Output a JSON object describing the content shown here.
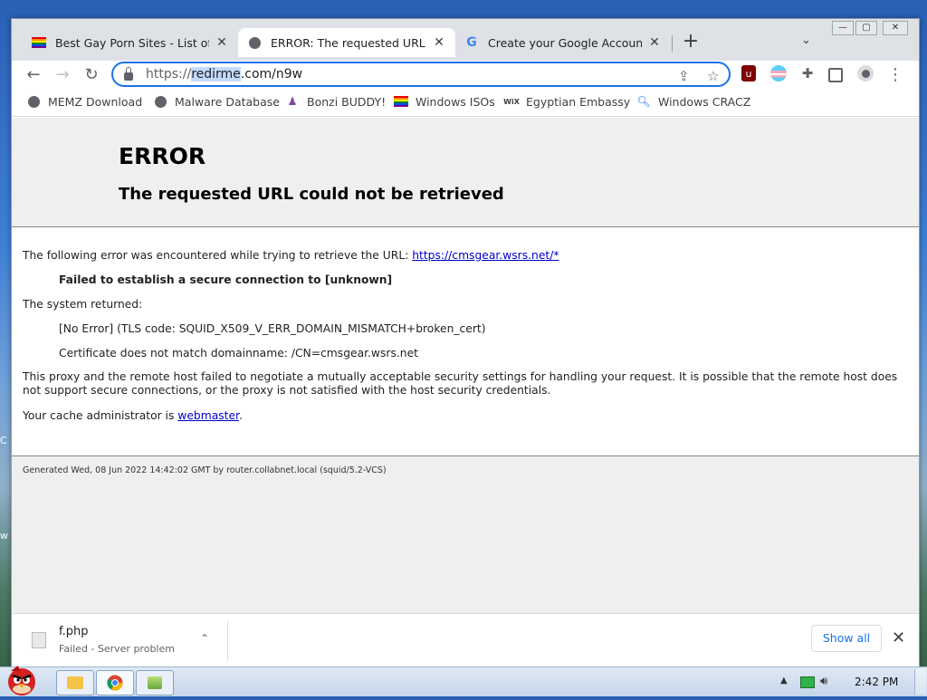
{
  "desktop": {
    "edge_text_1": "C",
    "edge_text_2": "w"
  },
  "window": {
    "minimize": "—",
    "maximize": "▢",
    "close": "✕"
  },
  "tabs": [
    {
      "title": "Best Gay Porn Sites - List of To",
      "close": "✕"
    },
    {
      "title": "ERROR: The requested URL co",
      "close": "✕"
    },
    {
      "title": "Create your Google Account",
      "close": "✕"
    }
  ],
  "toolbar": {
    "new_tab": "+",
    "tab_menu": "⌄",
    "back": "←",
    "forward": "→",
    "reload": "↻",
    "url_scheme": "https://",
    "url_selected": "redirme",
    "url_rest": ".com/n9w",
    "share": "⇪",
    "star": "☆",
    "more": "⋮"
  },
  "bookmarks": [
    {
      "label": "MEMZ Download",
      "icon": "globe-icon"
    },
    {
      "label": "Malware Database",
      "icon": "globe-icon"
    },
    {
      "label": "Bonzi BUDDY!",
      "icon": "bonzi-icon"
    },
    {
      "label": "Windows ISOs",
      "icon": "rainbow-flag-icon"
    },
    {
      "label": "Egyptian Embassy",
      "icon": "wix-icon"
    },
    {
      "label": "Windows CRACZ",
      "icon": "search-icon"
    }
  ],
  "bookmark_wix": "WiX",
  "page": {
    "title": "ERROR",
    "subtitle": "The requested URL could not be retrieved",
    "intro": "The following error was encountered while trying to retrieve the URL: ",
    "intro_link": "https://cmsgear.wsrs.net/*",
    "failed": "Failed to establish a secure connection to [unknown]",
    "system_returned": "The system returned:",
    "no_error": "[No Error] (TLS code: SQUID_X509_V_ERR_DOMAIN_MISMATCH+broken_cert)",
    "cert": "Certificate does not match domainname: /CN=cmsgear.wsrs.net",
    "proxy_text": "This proxy and the remote host failed to negotiate a mutually acceptable security settings for handling your request. It is possible that the remote host does not support secure connections, or the proxy is not satisfied with the host security credentials.",
    "admin_prefix": "Your cache administrator is ",
    "admin_link": "webmaster",
    "admin_suffix": ".",
    "footer": "Generated Wed, 08 Jun 2022 14:42:02 GMT by router.collabnet.local (squid/5.2-VCS)"
  },
  "download": {
    "filename": "f.php",
    "status": "Failed - Server problem",
    "chevron": "⌃",
    "show_all": "Show all",
    "close": "✕"
  },
  "taskbar": {
    "clock": "2:42 PM",
    "arrow": "▲"
  }
}
